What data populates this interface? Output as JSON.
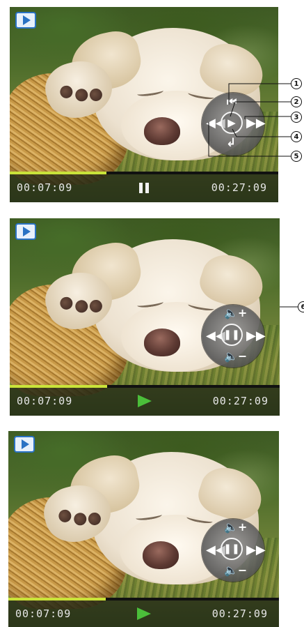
{
  "panels": [
    {
      "mode_icon": "video-play-icon",
      "elapsed": "00:07:09",
      "total": "00:27:09",
      "progress": 0.36,
      "state_icon": "pause-icon",
      "controls": [
        "skip-start-icon",
        "play-icon",
        "fast-forward-icon",
        "back-icon",
        "rewind-icon"
      ]
    },
    {
      "mode_icon": "video-play-icon",
      "elapsed": "00:07:09",
      "total": "00:27:09",
      "progress": 0.36,
      "state_icon": "play-icon",
      "controls": [
        "volume-up-icon",
        "rewind-icon",
        "pause-icon",
        "fast-forward-icon",
        "volume-down-icon"
      ]
    },
    {
      "mode_icon": "video-play-icon",
      "elapsed": "00:07:09",
      "total": "00:27:09",
      "progress": 0.36,
      "state_icon": "play-icon",
      "controls": [
        "volume-up-icon",
        "rewind-icon",
        "pause-icon",
        "fast-forward-icon",
        "volume-down-icon"
      ]
    }
  ],
  "callouts": [
    "1",
    "2",
    "3",
    "4",
    "5",
    "6"
  ],
  "colors": {
    "progress": "#c9e33a",
    "play_green": "#4bbe3a",
    "badge_blue": "#2a72c4"
  }
}
